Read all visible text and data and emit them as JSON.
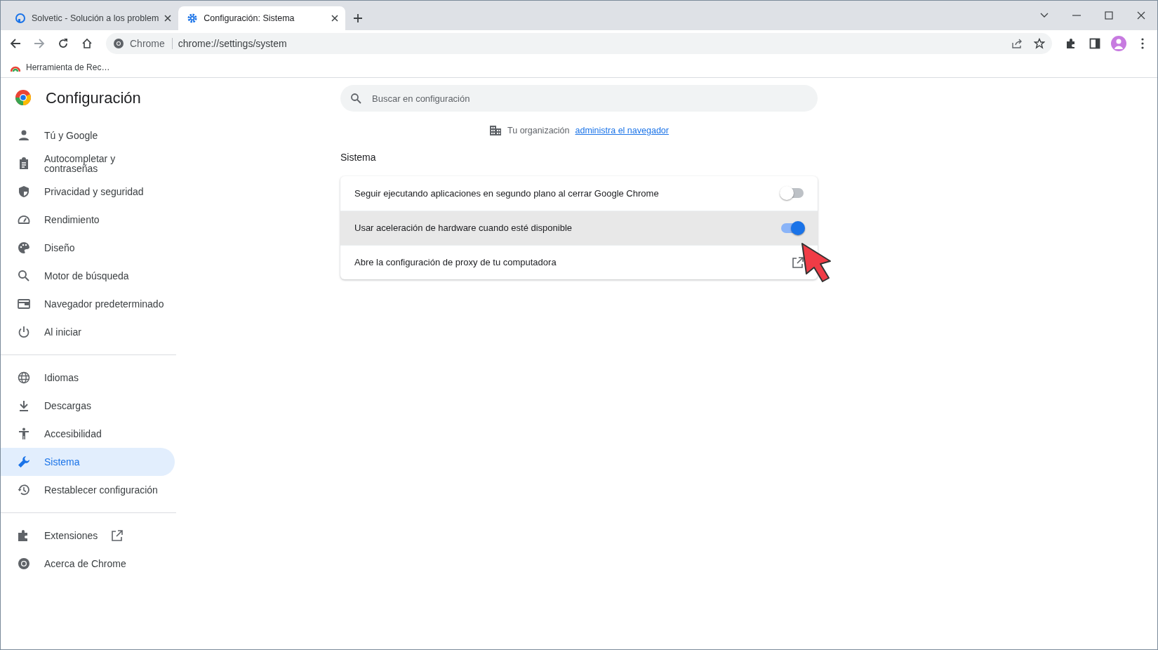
{
  "browser": {
    "tabs": [
      {
        "title": "Solvetic - Solución a los problem",
        "selected": false
      },
      {
        "title": "Configuración: Sistema",
        "selected": true
      }
    ],
    "omnibox": {
      "chip": "Chrome",
      "url": "chrome://settings/system"
    },
    "bookmarks": [
      "Herramienta de Rec…"
    ]
  },
  "sidebar": {
    "title": "Configuración",
    "groups": [
      {
        "items": [
          {
            "label": "Tú y Google",
            "selected": false
          },
          {
            "label": "Autocompletar y contraseñas",
            "selected": false
          },
          {
            "label": "Privacidad y seguridad",
            "selected": false
          },
          {
            "label": "Rendimiento",
            "selected": false
          },
          {
            "label": "Diseño",
            "selected": false
          },
          {
            "label": "Motor de búsqueda",
            "selected": false
          },
          {
            "label": "Navegador predeterminado",
            "selected": false
          },
          {
            "label": "Al iniciar",
            "selected": false
          }
        ]
      },
      {
        "items": [
          {
            "label": "Idiomas",
            "selected": false
          },
          {
            "label": "Descargas",
            "selected": false
          },
          {
            "label": "Accesibilidad",
            "selected": false
          },
          {
            "label": "Sistema",
            "selected": true
          },
          {
            "label": "Restablecer configuración",
            "selected": false
          }
        ]
      },
      {
        "items": [
          {
            "label": "Extensiones",
            "selected": false,
            "external": true
          },
          {
            "label": "Acerca de Chrome",
            "selected": false,
            "external": false
          }
        ]
      }
    ]
  },
  "search": {
    "placeholder": "Buscar en configuración"
  },
  "managed_notice": {
    "text": "Tu organización",
    "link": "administra el navegador"
  },
  "section": {
    "title": "Sistema",
    "rows": [
      {
        "kind": "toggle",
        "label": "Seguir ejecutando aplicaciones en segundo plano al cerrar Google Chrome",
        "on": false,
        "highlighted": false
      },
      {
        "kind": "toggle",
        "label": "Usar aceleración de hardware cuando esté disponible",
        "on": true,
        "highlighted": true
      },
      {
        "kind": "link",
        "label": "Abre la configuración de proxy de tu computadora",
        "highlighted": false
      }
    ]
  }
}
